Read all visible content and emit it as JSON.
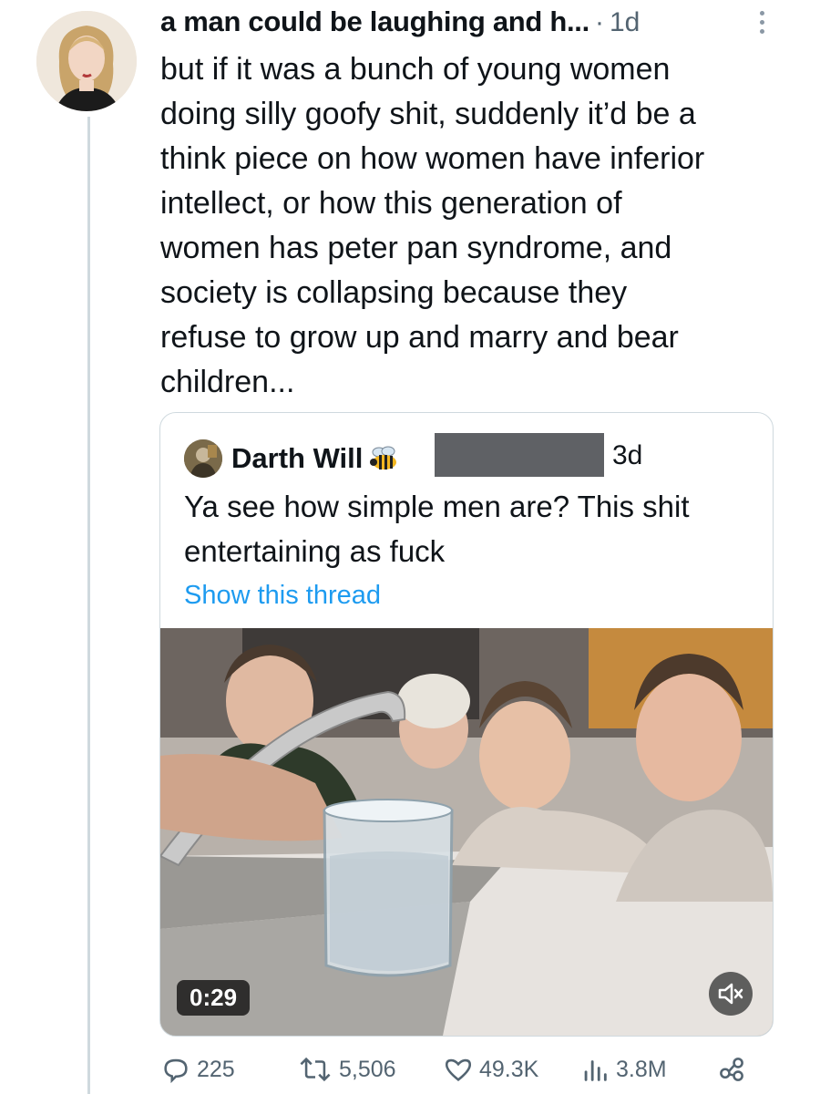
{
  "tweet": {
    "author": "a man could be laughing and h...",
    "separator": "·",
    "age": "1d",
    "text": "but if it was a bunch of young women\ndoing silly goofy shit, suddenly it’d be a\nthink piece on how women have inferior\nintellect, or how this generation of\nwomen has peter pan syndrome, and\nsociety is collapsing because they\nrefuse to grow up and marry and bear\nchildren..."
  },
  "quote": {
    "author": "Darth Will",
    "badge_icon": "bee-icon",
    "age": "3d",
    "text": "Ya see how simple men are? This shit\nentertaining as fuck",
    "show_thread": "Show this thread",
    "video": {
      "duration": "0:29",
      "mute_icon": "speaker-muted-icon"
    }
  },
  "actions": {
    "replies": "225",
    "reposts": "5,506",
    "likes": "49.3K",
    "views": "3.8M"
  },
  "colors": {
    "link": "#1d9bf0",
    "muted_text": "#536471",
    "border": "#cfd9de"
  }
}
